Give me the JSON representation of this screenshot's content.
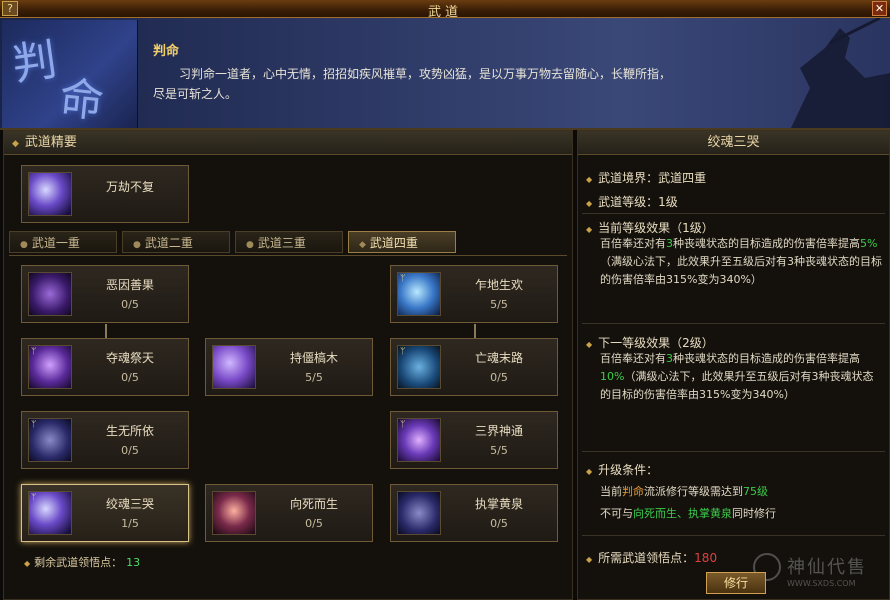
{
  "window": {
    "title": "武道",
    "help_label": "?",
    "close_label": "✕"
  },
  "header": {
    "emblem_char_1": "判",
    "emblem_char_2": "命",
    "name": "判命",
    "description": "习判命一道者，心中无情，招招如疾风摧草，攻势凶猛，是以万事万物去留随心，长鞭所指，尽是可斩之人。"
  },
  "left": {
    "section_title": "武道精要",
    "core_skill": {
      "name": "万劫不复",
      "icon": "purple-vortex-icon"
    },
    "tabs": [
      {
        "label": "武道一重",
        "active": false
      },
      {
        "label": "武道二重",
        "active": false
      },
      {
        "label": "武道三重",
        "active": false
      },
      {
        "label": "武道四重",
        "active": true
      }
    ],
    "skills": [
      {
        "name": "恶因善果",
        "level": "0/5",
        "icon": "dark-spirit-icon"
      },
      {
        "name": "乍地生欢",
        "level": "5/5",
        "icon": "blue-spirit-icon"
      },
      {
        "name": "夺魂祭天",
        "level": "0/5",
        "icon": "purple-spirit-icon"
      },
      {
        "name": "持僵槁木",
        "level": "5/5",
        "icon": "violet-spirit-icon"
      },
      {
        "name": "亡魂末路",
        "level": "0/5",
        "icon": "cyan-spirit-icon"
      },
      {
        "name": "生无所依",
        "level": "0/5",
        "icon": "lavender-spirit-icon"
      },
      {
        "name": "三界神通",
        "level": "5/5",
        "icon": "magenta-spirit-icon"
      },
      {
        "name": "绞魂三哭",
        "level": "1/5",
        "icon": "violet-swirl-icon"
      },
      {
        "name": "向死而生",
        "level": "0/5",
        "icon": "red-spirit-icon"
      },
      {
        "name": "执掌黄泉",
        "level": "0/5",
        "icon": "indigo-spirit-icon"
      }
    ],
    "remaining_label": "剩余武道领悟点：",
    "remaining_value": "13"
  },
  "right": {
    "section_title": "绞魂三哭",
    "realm_label": "武道境界：武道四重",
    "level_label": "武道等级：1级",
    "current_title": "当前等级效果（1级）",
    "current_text_1": "百倍奉还对有",
    "current_num_1": "3",
    "current_text_2": "种丧魂状态的目标造成的伤害倍率提高",
    "current_pct": "5%",
    "current_text_3": "（满级心法下，此效果升至五级后对有3种丧魂状态的目标的伤害倍率由315%变为340%）",
    "next_title": "下一等级效果（2级）",
    "next_text_1": "百倍奉还对有",
    "next_num_1": "3",
    "next_text_2": "种丧魂状态的目标造成的伤害倍率提高",
    "next_pct": "10%",
    "next_text_3": "（满级心法下，此效果升至五级后对有3种丧魂状态的目标的伤害倍率由315%变为340%）",
    "req_title": "升级条件：",
    "req_line1_a": "当前",
    "req_line1_b": "判命",
    "req_line1_c": "流派修行等级需达到",
    "req_line1_d": "75级",
    "req_line2_a": "不可与",
    "req_line2_b": "向死而生、执掌黄泉",
    "req_line2_c": "同时修行",
    "points_label": "所需武道领悟点：",
    "points_value": "180",
    "practice_button": "修行",
    "watermark_text": "神仙代售",
    "watermark_url": "WWW.SXDS.COM"
  },
  "colors": {
    "accent_gold": "#c9a24a",
    "green": "#3ccc4a",
    "red": "#e04040"
  }
}
